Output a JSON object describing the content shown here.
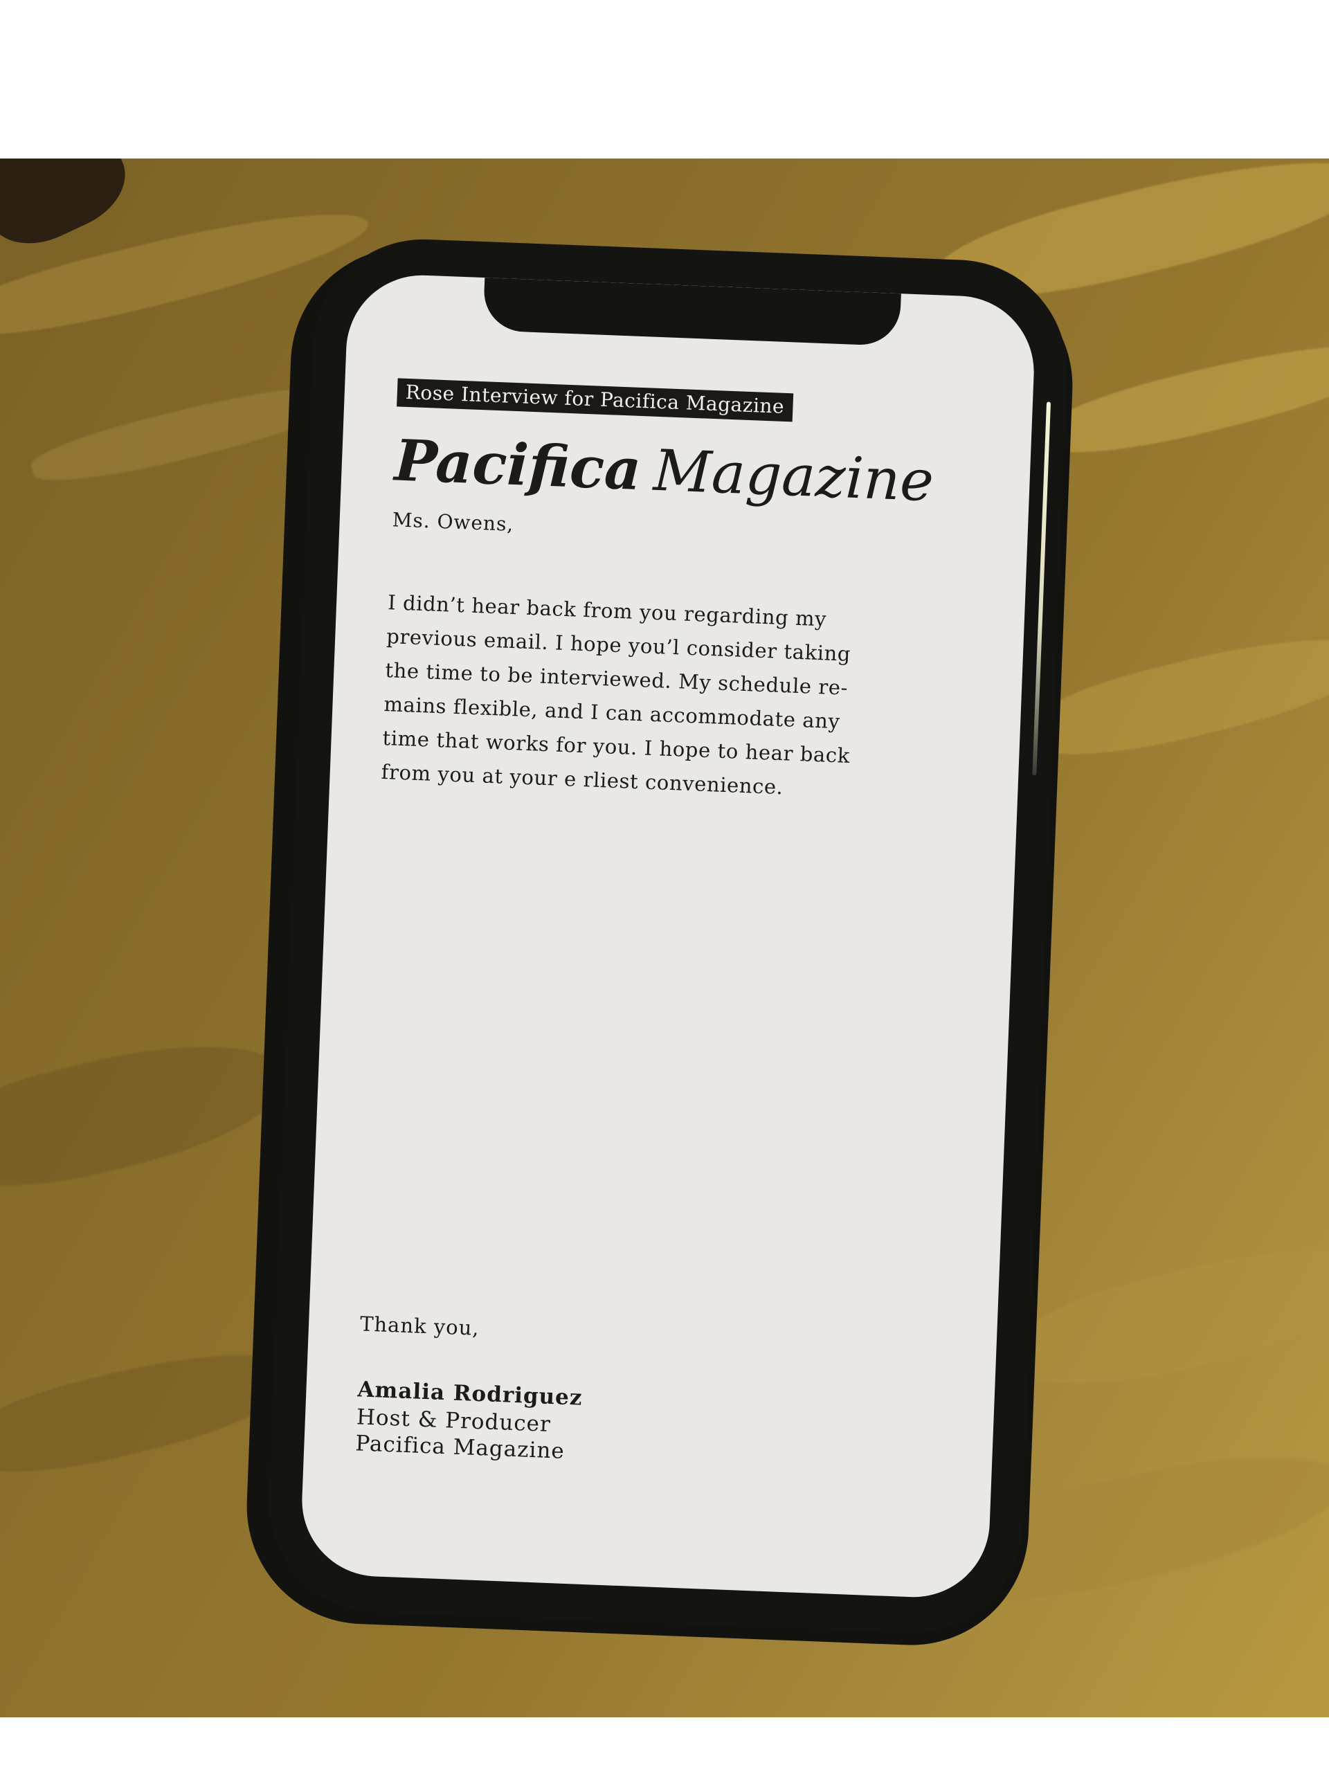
{
  "email": {
    "subject": "Rose Interview for Pacifica Magazine",
    "masthead": {
      "bold": "Pacifica",
      "light": "Magazine"
    },
    "greeting": "Ms. Owens,",
    "body_lines": [
      "I didn’t hear back from you regarding my",
      "previous email. I hope you’l  consider taking",
      "the time to be interviewed. My schedule re-",
      "mains flexible, and I can accommodate any",
      "time that works for you. I hope to hear back",
      "from you at your e  rliest convenience."
    ],
    "signoff": "Thank you,",
    "signature": {
      "name": "Amalia Rodriguez",
      "role": "Host & Producer",
      "organization": "Pacifica Magazine"
    }
  },
  "colors": {
    "backdrop": "#8b6f2c",
    "phone_body": "#141412",
    "screen": "#e9e8e4",
    "text": "#1d1b19"
  }
}
